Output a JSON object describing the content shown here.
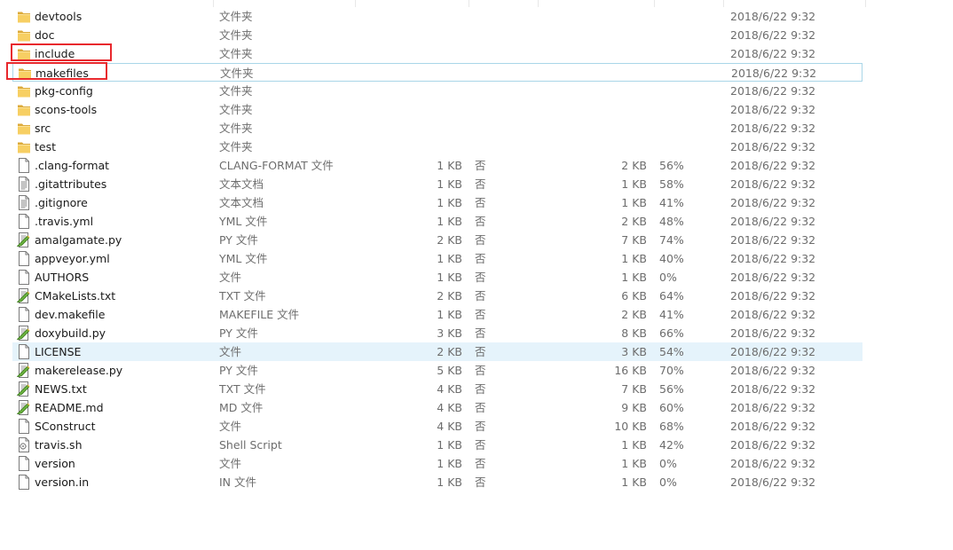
{
  "files": [
    {
      "name": "devtools",
      "type": "文件夹",
      "size": "",
      "encrypted": "",
      "packed": "",
      "ratio": "",
      "modified": "2018/6/22 9:32",
      "icon": "folder-icon"
    },
    {
      "name": "doc",
      "type": "文件夹",
      "size": "",
      "encrypted": "",
      "packed": "",
      "ratio": "",
      "modified": "2018/6/22 9:32",
      "icon": "folder-icon"
    },
    {
      "name": "include",
      "type": "文件夹",
      "size": "",
      "encrypted": "",
      "packed": "",
      "ratio": "",
      "modified": "2018/6/22 9:32",
      "icon": "folder-icon"
    },
    {
      "name": "makefiles",
      "type": "文件夹",
      "size": "",
      "encrypted": "",
      "packed": "",
      "ratio": "",
      "modified": "2018/6/22 9:32",
      "icon": "folder-icon"
    },
    {
      "name": "pkg-config",
      "type": "文件夹",
      "size": "",
      "encrypted": "",
      "packed": "",
      "ratio": "",
      "modified": "2018/6/22 9:32",
      "icon": "folder-icon"
    },
    {
      "name": "scons-tools",
      "type": "文件夹",
      "size": "",
      "encrypted": "",
      "packed": "",
      "ratio": "",
      "modified": "2018/6/22 9:32",
      "icon": "folder-icon"
    },
    {
      "name": "src",
      "type": "文件夹",
      "size": "",
      "encrypted": "",
      "packed": "",
      "ratio": "",
      "modified": "2018/6/22 9:32",
      "icon": "folder-icon"
    },
    {
      "name": "test",
      "type": "文件夹",
      "size": "",
      "encrypted": "",
      "packed": "",
      "ratio": "",
      "modified": "2018/6/22 9:32",
      "icon": "folder-icon"
    },
    {
      "name": ".clang-format",
      "type": "CLANG-FORMAT 文件",
      "size": "1 KB",
      "encrypted": "否",
      "packed": "2 KB",
      "ratio": "56%",
      "modified": "2018/6/22 9:32",
      "icon": "blank-file-icon"
    },
    {
      "name": ".gitattributes",
      "type": "文本文档",
      "size": "1 KB",
      "encrypted": "否",
      "packed": "1 KB",
      "ratio": "58%",
      "modified": "2018/6/22 9:32",
      "icon": "text-file-icon"
    },
    {
      "name": ".gitignore",
      "type": "文本文档",
      "size": "1 KB",
      "encrypted": "否",
      "packed": "1 KB",
      "ratio": "41%",
      "modified": "2018/6/22 9:32",
      "icon": "text-file-icon"
    },
    {
      "name": ".travis.yml",
      "type": "YML 文件",
      "size": "1 KB",
      "encrypted": "否",
      "packed": "2 KB",
      "ratio": "48%",
      "modified": "2018/6/22 9:32",
      "icon": "blank-file-icon"
    },
    {
      "name": "amalgamate.py",
      "type": "PY 文件",
      "size": "2 KB",
      "encrypted": "否",
      "packed": "7 KB",
      "ratio": "74%",
      "modified": "2018/6/22 9:32",
      "icon": "script-file-icon"
    },
    {
      "name": "appveyor.yml",
      "type": "YML 文件",
      "size": "1 KB",
      "encrypted": "否",
      "packed": "1 KB",
      "ratio": "40%",
      "modified": "2018/6/22 9:32",
      "icon": "blank-file-icon"
    },
    {
      "name": "AUTHORS",
      "type": "文件",
      "size": "1 KB",
      "encrypted": "否",
      "packed": "1 KB",
      "ratio": "0%",
      "modified": "2018/6/22 9:32",
      "icon": "blank-file-icon"
    },
    {
      "name": "CMakeLists.txt",
      "type": "TXT 文件",
      "size": "2 KB",
      "encrypted": "否",
      "packed": "6 KB",
      "ratio": "64%",
      "modified": "2018/6/22 9:32",
      "icon": "script-file-icon"
    },
    {
      "name": "dev.makefile",
      "type": "MAKEFILE 文件",
      "size": "1 KB",
      "encrypted": "否",
      "packed": "2 KB",
      "ratio": "41%",
      "modified": "2018/6/22 9:32",
      "icon": "blank-file-icon"
    },
    {
      "name": "doxybuild.py",
      "type": "PY 文件",
      "size": "3 KB",
      "encrypted": "否",
      "packed": "8 KB",
      "ratio": "66%",
      "modified": "2018/6/22 9:32",
      "icon": "script-file-icon"
    },
    {
      "name": "LICENSE",
      "type": "文件",
      "size": "2 KB",
      "encrypted": "否",
      "packed": "3 KB",
      "ratio": "54%",
      "modified": "2018/6/22 9:32",
      "icon": "blank-file-icon"
    },
    {
      "name": "makerelease.py",
      "type": "PY 文件",
      "size": "5 KB",
      "encrypted": "否",
      "packed": "16 KB",
      "ratio": "70%",
      "modified": "2018/6/22 9:32",
      "icon": "script-file-icon"
    },
    {
      "name": "NEWS.txt",
      "type": "TXT 文件",
      "size": "4 KB",
      "encrypted": "否",
      "packed": "7 KB",
      "ratio": "56%",
      "modified": "2018/6/22 9:32",
      "icon": "script-file-icon"
    },
    {
      "name": "README.md",
      "type": "MD 文件",
      "size": "4 KB",
      "encrypted": "否",
      "packed": "9 KB",
      "ratio": "60%",
      "modified": "2018/6/22 9:32",
      "icon": "script-file-icon"
    },
    {
      "name": "SConstruct",
      "type": "文件",
      "size": "4 KB",
      "encrypted": "否",
      "packed": "10 KB",
      "ratio": "68%",
      "modified": "2018/6/22 9:32",
      "icon": "blank-file-icon"
    },
    {
      "name": "travis.sh",
      "type": "Shell Script",
      "size": "1 KB",
      "encrypted": "否",
      "packed": "1 KB",
      "ratio": "42%",
      "modified": "2018/6/22 9:32",
      "icon": "shell-script-icon"
    },
    {
      "name": "version",
      "type": "文件",
      "size": "1 KB",
      "encrypted": "否",
      "packed": "1 KB",
      "ratio": "0%",
      "modified": "2018/6/22 9:32",
      "icon": "blank-file-icon"
    },
    {
      "name": "version.in",
      "type": "IN 文件",
      "size": "1 KB",
      "encrypted": "否",
      "packed": "1 KB",
      "ratio": "0%",
      "modified": "2018/6/22 9:32",
      "icon": "blank-file-icon"
    }
  ],
  "selection": {
    "outlined_item": "makefiles",
    "hover_item": "LICENSE"
  },
  "annotations": [
    "include",
    "makefiles"
  ],
  "colors": {
    "hover": "#e5f3fb",
    "outline": "#a9d6e8",
    "annotation": "#e8282d",
    "folder": "#f5c650"
  }
}
